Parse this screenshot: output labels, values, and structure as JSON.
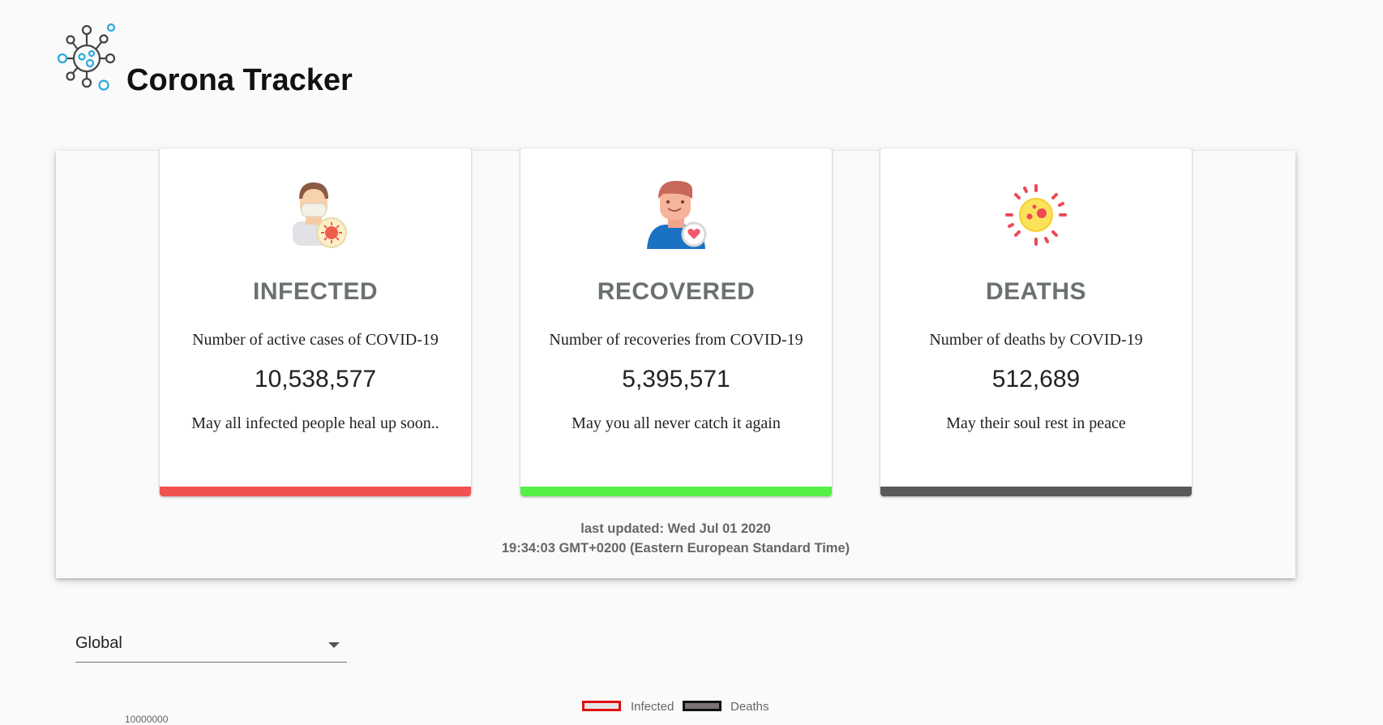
{
  "app": {
    "title": "Corona Tracker",
    "logo_icon": "virus-icon"
  },
  "cards": [
    {
      "key": "infected",
      "icon": "masked-person-icon",
      "title": "INFECTED",
      "description": "Number of active cases of COVID-19",
      "value": "10,538,577",
      "message": "May all infected people heal up soon..",
      "accent": "#f05252"
    },
    {
      "key": "recovered",
      "icon": "recovered-person-icon",
      "title": "RECOVERED",
      "description": "Number of recoveries from COVID-19",
      "value": "5,395,571",
      "message": "May you all never catch it again",
      "accent": "#55f046"
    },
    {
      "key": "deaths",
      "icon": "virus-cell-icon",
      "title": "DEATHS",
      "description": "Number of deaths by COVID-19",
      "value": "512,689",
      "message": "May their soul rest in peace",
      "accent": "#595959"
    }
  ],
  "last_updated": {
    "line1": "last updated: Wed Jul 01 2020",
    "line2": "19:34:03 GMT+0200 (Eastern European Standard Time)"
  },
  "country_select": {
    "value": "Global",
    "icon": "dropdown-arrow-icon"
  },
  "chart": {
    "legend": [
      {
        "label": "Infected",
        "fill": "#e6e6e6",
        "border": "#e01010"
      },
      {
        "label": "Deaths",
        "fill": "#7c7377",
        "border": "#111111"
      }
    ],
    "top_tick_partial": "10000000"
  }
}
